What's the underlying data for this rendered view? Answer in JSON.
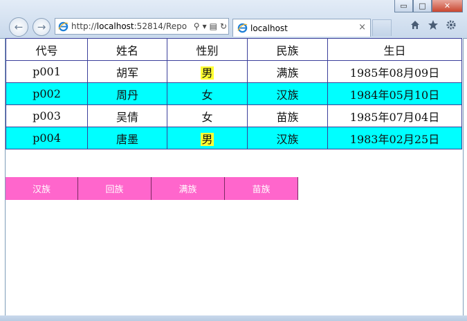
{
  "browser": {
    "url_prefix": "http://",
    "url_host": "localhost",
    "url_rest": ":52814/Repo",
    "tab_title": "localhost",
    "tab_close": "×",
    "win_minimize": "▭",
    "win_maximize": "□",
    "win_close": "✕"
  },
  "table": {
    "headers": [
      "代号",
      "姓名",
      "性别",
      "民族",
      "生日"
    ],
    "rows": [
      {
        "code": "p001",
        "name": "胡军",
        "sex": "男",
        "nation": "满族",
        "birthday": "1985年08月09日"
      },
      {
        "code": "p002",
        "name": "周丹",
        "sex": "女",
        "nation": "汉族",
        "birthday": "1984年05月10日"
      },
      {
        "code": "p003",
        "name": "吴倩",
        "sex": "女",
        "nation": "苗族",
        "birthday": "1985年07月04日"
      },
      {
        "code": "p004",
        "name": "唐墨",
        "sex": "男",
        "nation": "汉族",
        "birthday": "1983年02月25日"
      }
    ]
  },
  "nation_buttons": [
    "汉族",
    "回族",
    "满族",
    "苗族"
  ],
  "colors": {
    "row_alt": "#00ffff",
    "male_highlight": "#ffff33",
    "button_bg": "#ff66cc",
    "table_border": "#3a3f9a"
  }
}
